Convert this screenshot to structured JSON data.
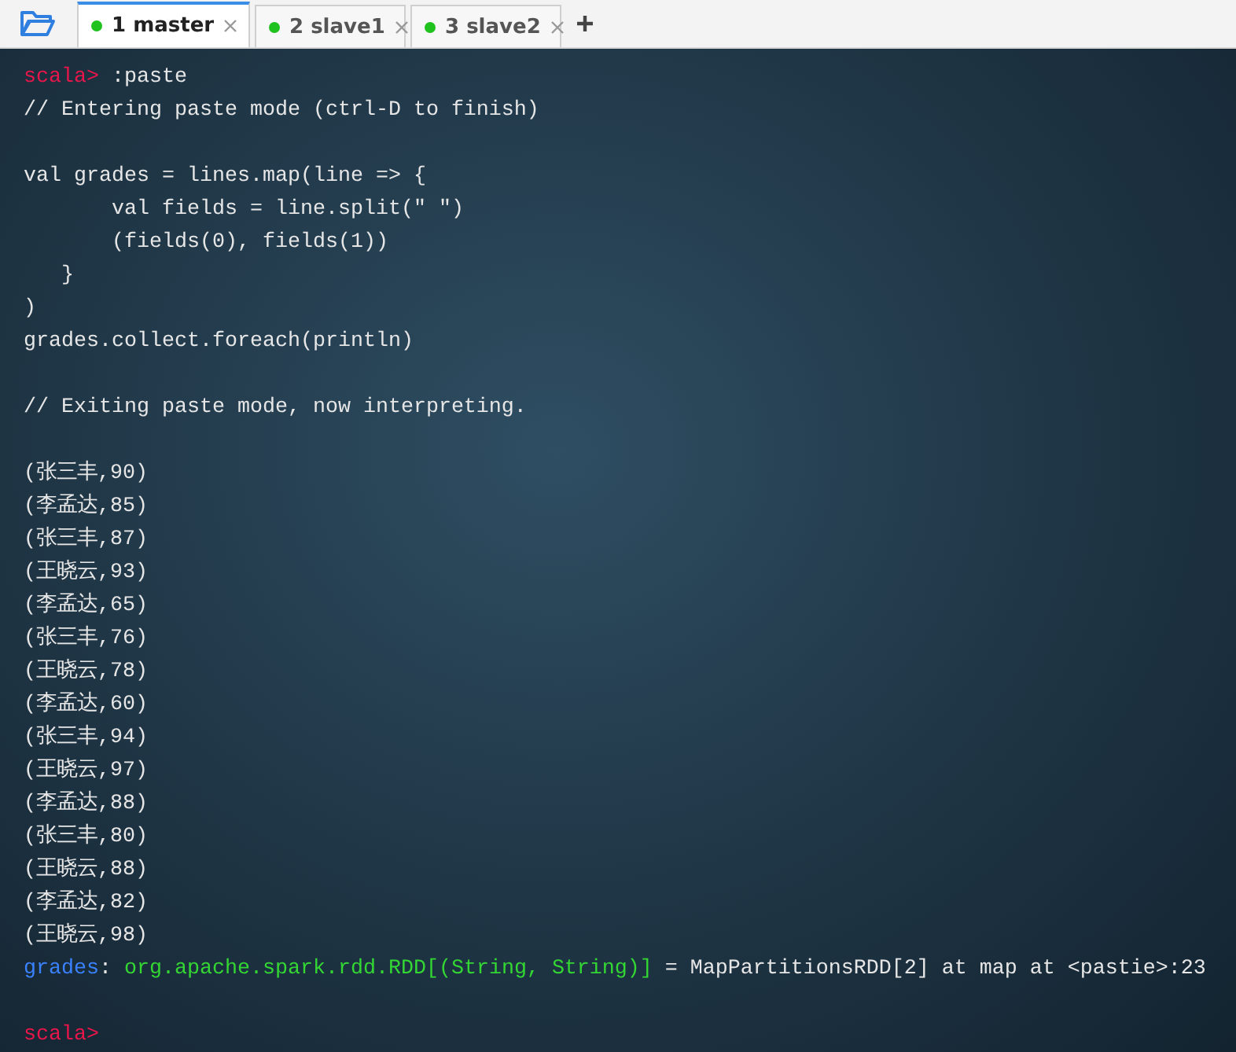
{
  "tabs": [
    {
      "label": "1 master",
      "selected": true
    },
    {
      "label": "2 slave1",
      "selected": false
    },
    {
      "label": "3 slave2",
      "selected": false
    }
  ],
  "terminal": {
    "lines": [
      {
        "kind": "text",
        "segments": [
          {
            "kind": "prompt",
            "text": "scala>"
          },
          {
            "kind": "plain",
            "text": " :paste"
          }
        ]
      },
      {
        "kind": "text",
        "segments": [
          {
            "kind": "plain",
            "text": "// Entering paste mode (ctrl-D to finish)"
          }
        ]
      },
      {
        "kind": "blank"
      },
      {
        "kind": "text",
        "segments": [
          {
            "kind": "plain",
            "text": "val grades = lines.map(line => {"
          }
        ]
      },
      {
        "kind": "text",
        "segments": [
          {
            "kind": "plain",
            "text": "       val fields = line.split(\" \")"
          }
        ]
      },
      {
        "kind": "text",
        "segments": [
          {
            "kind": "plain",
            "text": "       (fields(0), fields(1))"
          }
        ]
      },
      {
        "kind": "text",
        "segments": [
          {
            "kind": "plain",
            "text": "   }"
          }
        ]
      },
      {
        "kind": "text",
        "segments": [
          {
            "kind": "plain",
            "text": ")"
          }
        ]
      },
      {
        "kind": "text",
        "segments": [
          {
            "kind": "plain",
            "text": "grades.collect.foreach(println)"
          }
        ]
      },
      {
        "kind": "blank"
      },
      {
        "kind": "text",
        "segments": [
          {
            "kind": "plain",
            "text": "// Exiting paste mode, now interpreting."
          }
        ]
      },
      {
        "kind": "blank"
      },
      {
        "kind": "text",
        "segments": [
          {
            "kind": "plain",
            "text": "(张三丰,90)"
          }
        ]
      },
      {
        "kind": "text",
        "segments": [
          {
            "kind": "plain",
            "text": "(李孟达,85)"
          }
        ]
      },
      {
        "kind": "text",
        "segments": [
          {
            "kind": "plain",
            "text": "(张三丰,87)"
          }
        ]
      },
      {
        "kind": "text",
        "segments": [
          {
            "kind": "plain",
            "text": "(王晓云,93)"
          }
        ]
      },
      {
        "kind": "text",
        "segments": [
          {
            "kind": "plain",
            "text": "(李孟达,65)"
          }
        ]
      },
      {
        "kind": "text",
        "segments": [
          {
            "kind": "plain",
            "text": "(张三丰,76)"
          }
        ]
      },
      {
        "kind": "text",
        "segments": [
          {
            "kind": "plain",
            "text": "(王晓云,78)"
          }
        ]
      },
      {
        "kind": "text",
        "segments": [
          {
            "kind": "plain",
            "text": "(李孟达,60)"
          }
        ]
      },
      {
        "kind": "text",
        "segments": [
          {
            "kind": "plain",
            "text": "(张三丰,94)"
          }
        ]
      },
      {
        "kind": "text",
        "segments": [
          {
            "kind": "plain",
            "text": "(王晓云,97)"
          }
        ]
      },
      {
        "kind": "text",
        "segments": [
          {
            "kind": "plain",
            "text": "(李孟达,88)"
          }
        ]
      },
      {
        "kind": "text",
        "segments": [
          {
            "kind": "plain",
            "text": "(张三丰,80)"
          }
        ]
      },
      {
        "kind": "text",
        "segments": [
          {
            "kind": "plain",
            "text": "(王晓云,88)"
          }
        ]
      },
      {
        "kind": "text",
        "segments": [
          {
            "kind": "plain",
            "text": "(李孟达,82)"
          }
        ]
      },
      {
        "kind": "text",
        "segments": [
          {
            "kind": "plain",
            "text": "(王晓云,98)"
          }
        ]
      },
      {
        "kind": "text",
        "segments": [
          {
            "kind": "name",
            "text": "grades"
          },
          {
            "kind": "plain",
            "text": ": "
          },
          {
            "kind": "type",
            "text": "org.apache.spark.rdd.RDD[(String, String)]"
          },
          {
            "kind": "plain",
            "text": " = MapPartitionsRDD[2] at map at <pastie>:23"
          }
        ]
      },
      {
        "kind": "blank"
      },
      {
        "kind": "text",
        "segments": [
          {
            "kind": "prompt",
            "text": "scala>"
          }
        ]
      }
    ]
  }
}
